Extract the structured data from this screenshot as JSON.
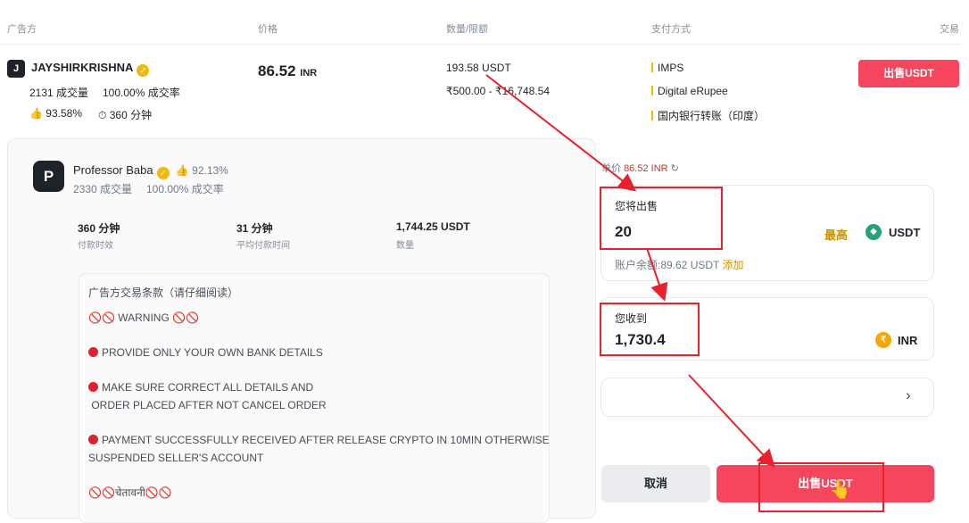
{
  "header": {
    "advertiser": "广告方",
    "price": "价格",
    "quantity": "数量/限额",
    "payment": "支付方式",
    "trade": "交易"
  },
  "listing": {
    "avatar_letter": "J",
    "name": "JAYSHIRKRISHNA",
    "orders": "2131 成交量",
    "completion": "100.00% 成交率",
    "rating": "93.58%",
    "time": "360 分钟",
    "price": "86.52",
    "currency": "INR",
    "available": "193.58 USDT",
    "limit": "₹500.00 - ₹16,748.54",
    "payments": [
      "IMPS",
      "Digital eRupee",
      "国内银行转账（印度）"
    ],
    "sell_button": "出售USDT"
  },
  "seller": {
    "avatar_letter": "P",
    "name": "Professor Baba",
    "rating": "92.13%",
    "orders": "2330 成交量",
    "completion": "100.00% 成交率",
    "stats": [
      {
        "value": "360 分钟",
        "label": "付款时效"
      },
      {
        "value": "31 分钟",
        "label": "平均付款时间"
      },
      {
        "value": "1,744.25 USDT",
        "label": "数量"
      }
    ]
  },
  "terms": {
    "title": "广告方交易条款（请仔细阅读）",
    "lines": [
      "WARNING",
      "PROVIDE ONLY YOUR OWN BANK DETAILS",
      "MAKE SURE CORRECT ALL DETAILS AND",
      "ORDER PLACED AFTER NOT CANCEL ORDER",
      "PAYMENT SUCCESSFULLY RECEIVED AFTER RELEASE CRYPTO IN 10MIN OTHERWISE",
      "SUSPENDED SELLER'S ACCOUNT",
      "चेतावनी"
    ]
  },
  "order": {
    "unit_price_prefix": "单价",
    "unit_price": "86.52 INR",
    "sell_label": "您将出售",
    "sell_value": "20",
    "max_label": "最高",
    "sell_currency": "USDT",
    "balance_label": "账户余额:89.62 USDT",
    "add_label": "添加",
    "receive_label": "您收到",
    "receive_value": "1,730.4",
    "receive_currency": "INR",
    "cancel_button": "取消",
    "confirm_button": "出售USDT"
  },
  "colors": {
    "accent_red": "#f6465d",
    "brand_yellow": "#f0b90b",
    "annotation_red": "#e8212c"
  }
}
